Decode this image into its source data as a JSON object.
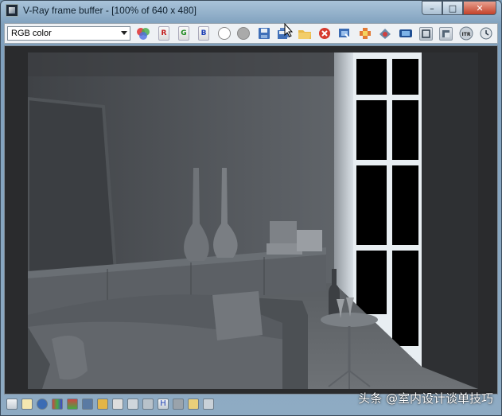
{
  "window": {
    "title": "V-Ray frame buffer - [100% of 640 x 480]",
    "caption_buttons": {
      "minimize": "–",
      "maximize": "□",
      "close": "✕"
    }
  },
  "toolbar": {
    "channel_value": "RGB color",
    "red_label": "R",
    "green_label": "G",
    "blue_label": "B",
    "icons": [
      "color-picker-icon",
      "red-channel",
      "green-channel",
      "blue-channel",
      "white-circle",
      "gray-circle",
      "save-icon",
      "save-all-icon",
      "open-icon",
      "clear-icon",
      "duplicate-icon",
      "track-mouse-icon",
      "lens-icon",
      "region-render-icon",
      "link-to-vfb-icon",
      "compare-icon",
      "history-icon"
    ]
  },
  "statusbar": {
    "icons": [
      "display-colors-icon",
      "info-icon",
      "lut-icon",
      "levels-icon",
      "curve-icon",
      "histogram-icon",
      "exposure-icon",
      "settings-icon",
      "icc-icon",
      "hsv-icon",
      "ocio-icon"
    ],
    "h_label": "H"
  },
  "watermark": {
    "text": "头条 @室内设计谈单技巧"
  },
  "colors": {
    "accent_close": "#c3422a",
    "render_bg": "#4a4d51"
  }
}
